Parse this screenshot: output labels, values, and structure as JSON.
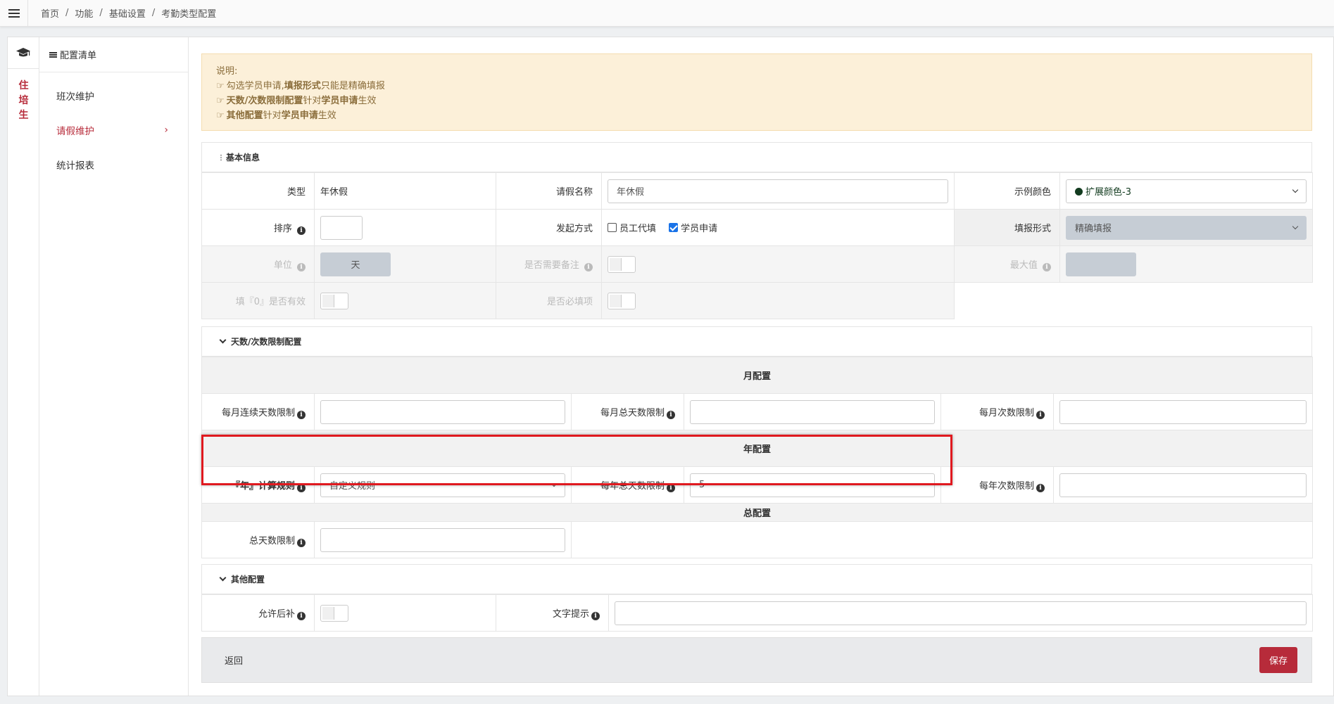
{
  "breadcrumb": [
    "首页",
    "功能",
    "基础设置",
    "考勤类型配置"
  ],
  "rail": {
    "label": "住\n培\n生"
  },
  "menu": {
    "title": "配置清单",
    "items": [
      {
        "label": "班次维护"
      },
      {
        "label": "请假维护",
        "active": true
      },
      {
        "label": "统计报表"
      }
    ]
  },
  "notice": {
    "title": "说明:",
    "line1_a": "勾选学员申请,",
    "line1_b": "填报形式",
    "line1_c": "只能是精确填报",
    "line2_a": "天数/次数限制配置",
    "line2_b": "针对",
    "line2_c": "学员申请",
    "line2_d": "生效",
    "line3_a": "其他配置",
    "line3_b": "针对",
    "line3_c": "学员申请",
    "line3_d": "生效"
  },
  "basic": {
    "title": "基本信息",
    "type_label": "类型",
    "type_value": "年休假",
    "name_label": "请假名称",
    "name_value": "年休假",
    "color_label": "示例颜色",
    "color_value": "扩展颜色-3",
    "order_label": "排序",
    "order_value": "",
    "launch_label": "发起方式",
    "launch_opt1": "员工代填",
    "launch_opt2": "学员申请",
    "fill_label": "填报形式",
    "fill_value": "精确填报",
    "unit_label": "单位",
    "unit_value": "天",
    "remark_label": "是否需要备注",
    "max_label": "最大值",
    "max_value": "",
    "zero_label": "填『0』是否有效",
    "required_label": "是否必填项"
  },
  "limits": {
    "title": "天数/次数限制配置",
    "month_head": "月配置",
    "m_cont_label": "每月连续天数限制",
    "m_cont_value": "",
    "m_total_label": "每月总天数限制",
    "m_total_value": "",
    "m_times_label": "每月次数限制",
    "m_times_value": "",
    "year_head": "年配置",
    "y_rule_label": "『年』计算规则",
    "y_rule_value": "自定义规则",
    "y_total_label": "每年总天数限制",
    "y_total_value": "5",
    "y_times_label": "每年次数限制",
    "y_times_value": "",
    "total_head": "总配置",
    "t_days_label": "总天数限制",
    "t_days_value": ""
  },
  "other": {
    "title": "其他配置",
    "allow_label": "允许后补",
    "tip_label": "文字提示",
    "tip_value": ""
  },
  "footer": {
    "back": "返回",
    "save": "保存"
  },
  "colors": {
    "accent": "#b72b3a",
    "notice_bg": "#fcf0d9",
    "highlight": "#e0191f"
  }
}
